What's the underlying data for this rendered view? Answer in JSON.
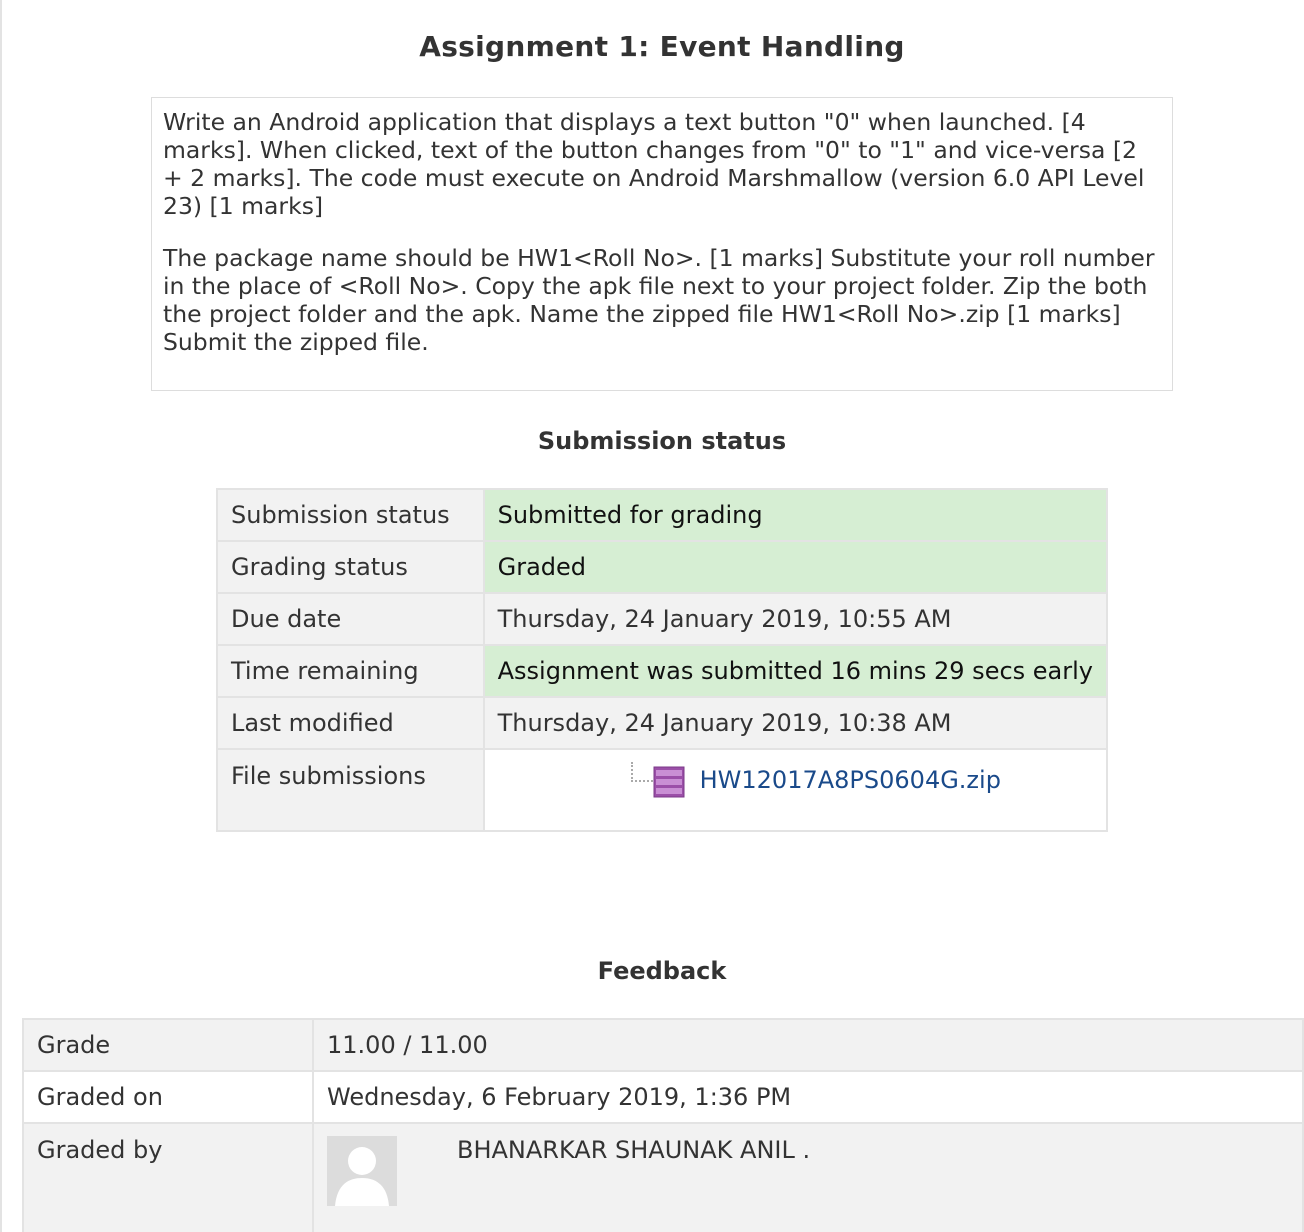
{
  "assignment": {
    "title": "Assignment 1: Event Handling",
    "intro_p1": "Write an Android application that displays a text button \"0\" when launched. [4 marks]. When clicked, text of the button changes from \"0\" to \"1\" and vice-versa [2 + 2 marks]. The code must execute on Android Marshmallow (version 6.0 API Level 23) [1 marks]",
    "intro_p2": "The package name should be HW1<Roll No>. [1 marks] Substitute your roll number in the place of <Roll No>. Copy the apk file next to your project folder. Zip the both the project folder and the apk. Name the zipped file HW1<Roll No>.zip [1 marks] Submit the zipped file."
  },
  "submission": {
    "heading": "Submission status",
    "rows": [
      {
        "label": "Submission status",
        "value": "Submitted for grading"
      },
      {
        "label": "Grading status",
        "value": "Graded"
      },
      {
        "label": "Due date",
        "value": "Thursday, 24 January 2019, 10:55 AM"
      },
      {
        "label": "Time remaining",
        "value": "Assignment was submitted 16 mins 29 secs early"
      },
      {
        "label": "Last modified",
        "value": "Thursday, 24 January 2019, 10:38 AM"
      },
      {
        "label": "File submissions",
        "value": ""
      }
    ],
    "file": {
      "name": "HW12017A8PS0604G.zip",
      "icon": "zip-archive-icon"
    }
  },
  "feedback": {
    "heading": "Feedback",
    "rows": [
      {
        "label": "Grade",
        "value": "11.00 / 11.00"
      },
      {
        "label": "Graded on",
        "value": "Wednesday, 6 February 2019, 1:36 PM"
      },
      {
        "label": "Graded by",
        "value": "BHANARKAR SHAUNAK ANIL ."
      }
    ]
  },
  "colors": {
    "success_bg": "#d6eed3",
    "label_bg": "#f2f2f2",
    "link": "#1a4a8a"
  }
}
